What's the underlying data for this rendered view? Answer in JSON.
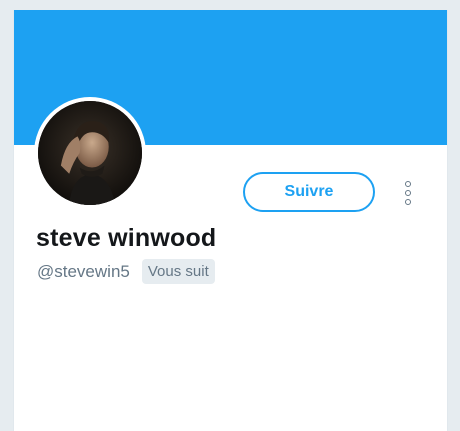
{
  "profile": {
    "display_name": "steve winwood",
    "handle": "@stevewin5",
    "follows_you_label": "Vous suit",
    "avatar_icon": "profile-photo",
    "banner_color": "#1da1f2"
  },
  "actions": {
    "follow_label": "Suivre",
    "more_icon": "more-vertical-icon",
    "accent_color": "#1da1f2"
  }
}
